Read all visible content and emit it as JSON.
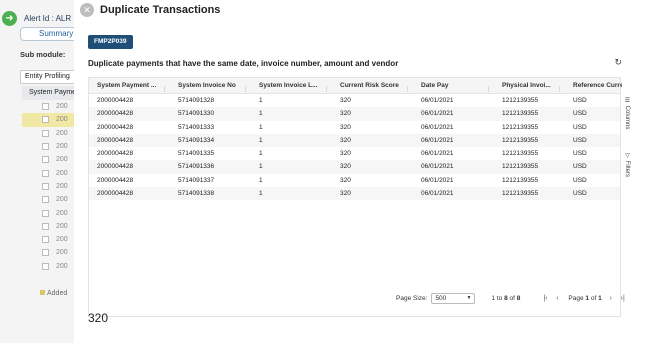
{
  "background": {
    "alert_label": "Alert Id : ALR",
    "summary_tab": "Summary",
    "sub_module_label": "Sub module:",
    "entity_label": "Entity Profiling",
    "column_header": "System Payme",
    "row_values": [
      "200",
      "200",
      "200",
      "200",
      "200",
      "200",
      "200",
      "200",
      "200",
      "200",
      "200",
      "200",
      "200"
    ],
    "added_label": "Added"
  },
  "modal": {
    "title": "Duplicate Transactions",
    "tag": "FMP2P039",
    "subtitle": "Duplicate payments that have the same date, invoice number, amount and vendor"
  },
  "grid": {
    "columns": [
      "System Payment ...",
      "System Invoice No",
      "System Invoice L...",
      "Current Risk Score",
      "Date Pay",
      "Physical Invoi...",
      "Reference Curre..."
    ],
    "rows": [
      [
        "2000004428",
        "5714091328",
        "1",
        "320",
        "06/01/2021",
        "1212139355",
        "USD"
      ],
      [
        "2000004428",
        "5714091330",
        "1",
        "320",
        "06/01/2021",
        "1212139355",
        "USD"
      ],
      [
        "2000004428",
        "5714091333",
        "1",
        "320",
        "06/01/2021",
        "1212139355",
        "USD"
      ],
      [
        "2000004428",
        "5714091334",
        "1",
        "320",
        "06/01/2021",
        "1212139355",
        "USD"
      ],
      [
        "2000004428",
        "5714091335",
        "1",
        "320",
        "06/01/2021",
        "1212139355",
        "USD"
      ],
      [
        "2000004428",
        "5714091336",
        "1",
        "320",
        "06/01/2021",
        "1212139355",
        "USD"
      ],
      [
        "2000004428",
        "5714091337",
        "1",
        "320",
        "06/01/2021",
        "1212139355",
        "USD"
      ],
      [
        "2000004428",
        "5714091338",
        "1",
        "320",
        "06/01/2021",
        "1212139355",
        "USD"
      ]
    ],
    "side_columns": "Columns",
    "side_filters": "Filters"
  },
  "pager": {
    "page_size_label": "Page Size:",
    "page_size_value": "500",
    "range_from": "1",
    "range_to": "8",
    "range_total": "8",
    "range_text": "to",
    "of_text": "of",
    "page_label": "Page",
    "page_current": "1",
    "page_total": "1"
  },
  "bottom_value": "320"
}
